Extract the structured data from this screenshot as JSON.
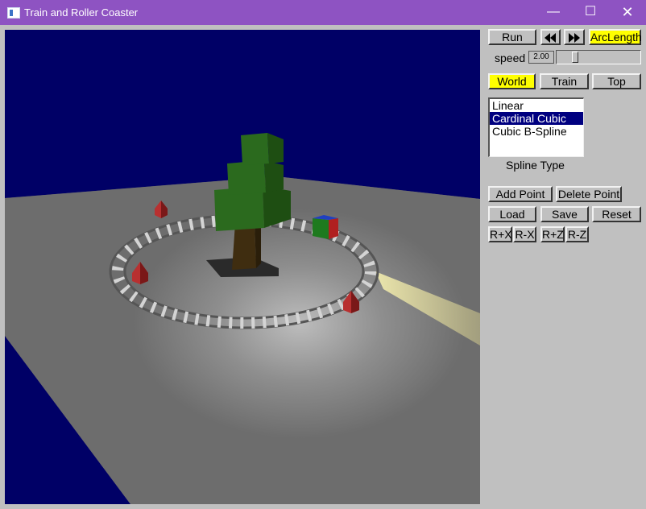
{
  "window": {
    "title": "Train and Roller Coaster",
    "minimize_icon": "minimize-icon",
    "maximize_icon": "maximize-icon",
    "close_icon": "close-icon",
    "min_glyph": "—",
    "max_glyph": "☐",
    "close_glyph": "✕"
  },
  "controls": {
    "run_label": "Run",
    "rewind_icon": "rewind-icon",
    "forward_icon": "fast-forward-icon",
    "arclength_label": "ArcLength",
    "speed_label": "speed",
    "speed_value": "2.00",
    "speed_slider_fraction": 0.2,
    "view_buttons": [
      "World",
      "Train",
      "Top"
    ],
    "active_view": "World",
    "spline_types": [
      "Linear",
      "Cardinal Cubic",
      "Cubic B-Spline"
    ],
    "selected_spline": "Cardinal Cubic",
    "spline_type_label": "Spline Type",
    "add_point_label": "Add Point",
    "delete_point_label": "Delete Point",
    "load_label": "Load",
    "save_label": "Save",
    "reset_label": "Reset",
    "rotate_buttons": [
      "R+X",
      "R-X",
      "R+Z",
      "R-Z"
    ]
  },
  "colors": {
    "title_bar": "#8e53c2",
    "highlight": "#ffff00",
    "list_selection": "#000080",
    "viewport_background": "#000066"
  },
  "scene": {
    "objects": [
      "ground-plane",
      "tree",
      "train-car",
      "control-points",
      "track",
      "headlight-beam"
    ]
  }
}
